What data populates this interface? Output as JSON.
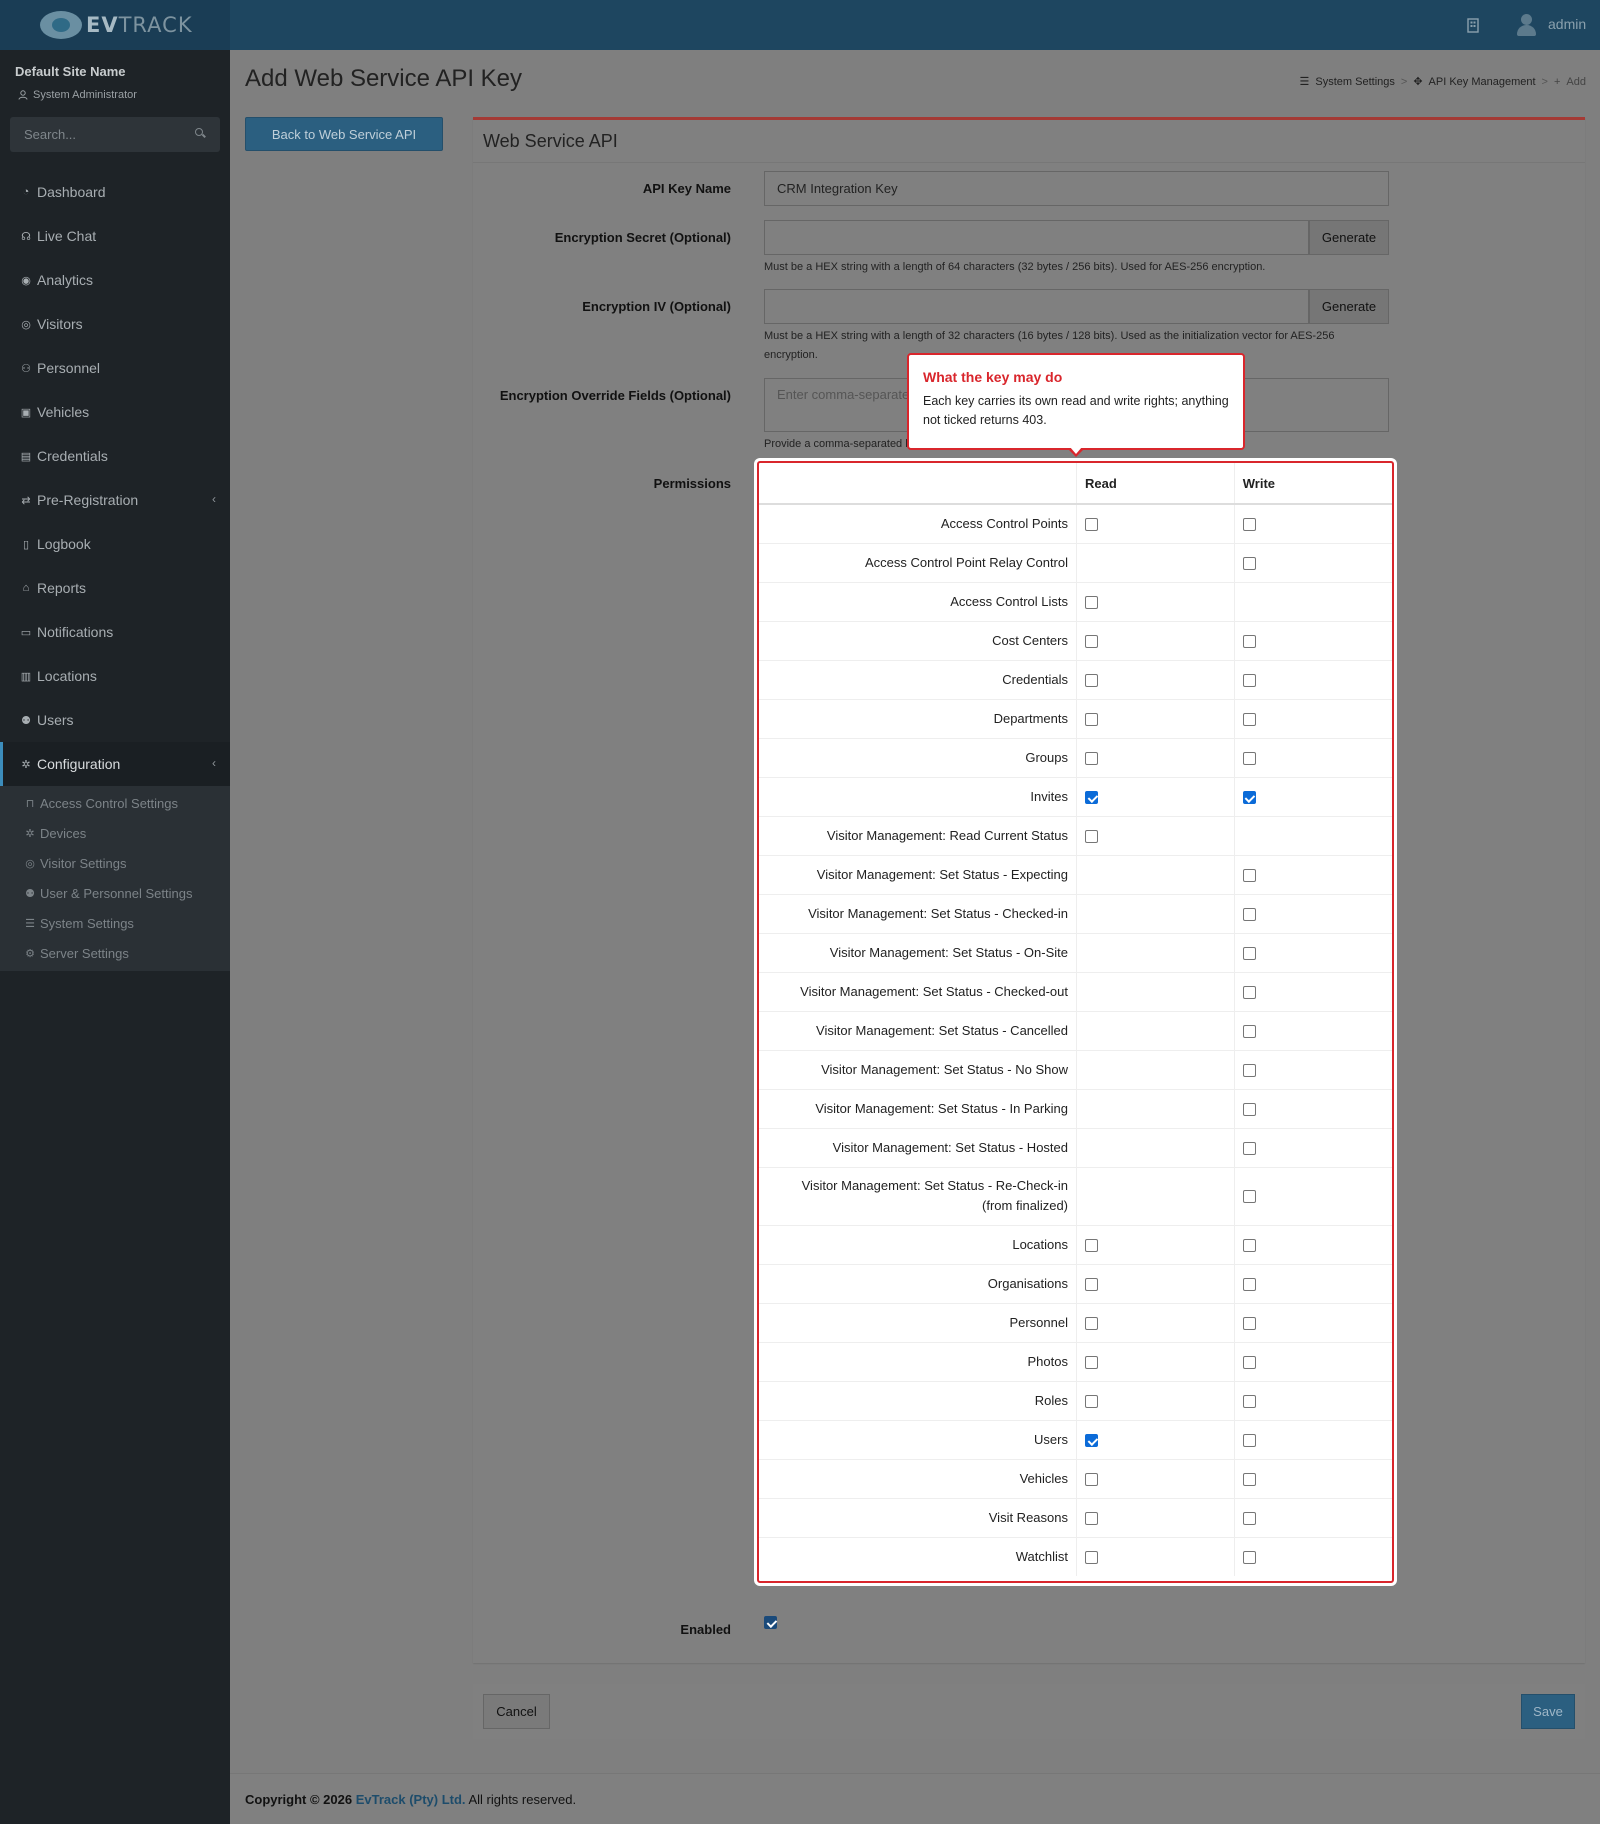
{
  "app": {
    "logo_text_bold": "EV",
    "logo_text": "TRACK"
  },
  "topbar": {
    "username": "admin"
  },
  "sidebar": {
    "site_name": "Default Site Name",
    "role": "System Administrator",
    "search_placeholder": "Search...",
    "items": [
      {
        "label": "Dashboard",
        "icon": "dashboard-icon"
      },
      {
        "label": "Live Chat",
        "icon": "headset-icon"
      },
      {
        "label": "Analytics",
        "icon": "analytics-icon"
      },
      {
        "label": "Visitors",
        "icon": "eye-icon"
      },
      {
        "label": "Personnel",
        "icon": "personnel-icon"
      },
      {
        "label": "Vehicles",
        "icon": "vehicle-icon"
      },
      {
        "label": "Credentials",
        "icon": "credentials-icon"
      },
      {
        "label": "Pre-Registration",
        "icon": "exchange-icon"
      },
      {
        "label": "Logbook",
        "icon": "logbook-icon"
      },
      {
        "label": "Reports",
        "icon": "reports-icon"
      },
      {
        "label": "Notifications",
        "icon": "notifications-icon"
      },
      {
        "label": "Locations",
        "icon": "locations-icon"
      },
      {
        "label": "Users",
        "icon": "users-icon"
      },
      {
        "label": "Configuration",
        "icon": "gear-icon"
      }
    ],
    "sub_items": [
      {
        "label": "Access Control Settings",
        "icon": "lock-icon"
      },
      {
        "label": "Devices",
        "icon": "devices-icon"
      },
      {
        "label": "Visitor Settings",
        "icon": "eye-icon"
      },
      {
        "label": "User & Personnel Settings",
        "icon": "users-icon"
      },
      {
        "label": "System Settings",
        "icon": "sliders-icon"
      },
      {
        "label": "Server Settings",
        "icon": "server-icon"
      }
    ]
  },
  "header": {
    "title": "Add Web Service API Key",
    "breadcrumb": [
      "System Settings",
      "API Key Management",
      "Add"
    ],
    "back_label": "Back to Web Service API"
  },
  "form": {
    "panel_title": "Web Service API",
    "api_key_name_label": "API Key Name",
    "api_key_name_value": "CRM Integration Key",
    "secret_label": "Encryption Secret (Optional)",
    "secret_help": "Must be a HEX string with a length of 64 characters (32 bytes / 256 bits). Used for AES-256 encryption.",
    "iv_label": "Encryption IV (Optional)",
    "iv_help": "Must be a HEX string with a length of 32 characters (16 bytes / 128 bits). Used as the initialization vector for AES-256 encryption.",
    "generate_label": "Generate",
    "override_label": "Encryption Override Fields (Optional)",
    "override_placeholder": "Enter comma-separated field names",
    "override_help": "Provide a comma-separated list of fields",
    "permissions_label": "Permissions",
    "enabled_label": "Enabled",
    "enabled": true
  },
  "permissions": {
    "col_read": "Read",
    "col_write": "Write",
    "rows": [
      {
        "label": "Access Control Points",
        "read": false,
        "write": false
      },
      {
        "label": "Access Control Point Relay Control",
        "read": null,
        "write": false
      },
      {
        "label": "Access Control Lists",
        "read": false,
        "write": null
      },
      {
        "label": "Cost Centers",
        "read": false,
        "write": false
      },
      {
        "label": "Credentials",
        "read": false,
        "write": false
      },
      {
        "label": "Departments",
        "read": false,
        "write": false
      },
      {
        "label": "Groups",
        "read": false,
        "write": false
      },
      {
        "label": "Invites",
        "read": true,
        "write": true
      },
      {
        "label": "Visitor Management: Read Current Status",
        "read": false,
        "write": null
      },
      {
        "label": "Visitor Management: Set Status - Expecting",
        "read": null,
        "write": false
      },
      {
        "label": "Visitor Management: Set Status - Checked-in",
        "read": null,
        "write": false
      },
      {
        "label": "Visitor Management: Set Status - On-Site",
        "read": null,
        "write": false
      },
      {
        "label": "Visitor Management: Set Status - Checked-out",
        "read": null,
        "write": false
      },
      {
        "label": "Visitor Management: Set Status - Cancelled",
        "read": null,
        "write": false
      },
      {
        "label": "Visitor Management: Set Status - No Show",
        "read": null,
        "write": false
      },
      {
        "label": "Visitor Management: Set Status - In Parking",
        "read": null,
        "write": false
      },
      {
        "label": "Visitor Management: Set Status - Hosted",
        "read": null,
        "write": false
      },
      {
        "label": "Visitor Management: Set Status - Re-Check-in (from finalized)",
        "read": null,
        "write": false
      },
      {
        "label": "Locations",
        "read": false,
        "write": false
      },
      {
        "label": "Organisations",
        "read": false,
        "write": false
      },
      {
        "label": "Personnel",
        "read": false,
        "write": false
      },
      {
        "label": "Photos",
        "read": false,
        "write": false
      },
      {
        "label": "Roles",
        "read": false,
        "write": false
      },
      {
        "label": "Users",
        "read": true,
        "write": false
      },
      {
        "label": "Vehicles",
        "read": false,
        "write": false
      },
      {
        "label": "Visit Reasons",
        "read": false,
        "write": false
      },
      {
        "label": "Watchlist",
        "read": false,
        "write": false
      }
    ]
  },
  "callout": {
    "title": "What the key may do",
    "body": "Each key carries its own read and write rights; anything not ticked returns 403."
  },
  "actions": {
    "cancel_label": "Cancel",
    "save_label": "Save"
  },
  "footer": {
    "prefix": "Copyright © 2026",
    "company": "EvTrack (Pty) Ltd.",
    "suffix": "All rights reserved."
  },
  "colors": {
    "accent": "#2b5f80",
    "highlight": "#d9262c",
    "checked": "#0b6bd8"
  }
}
